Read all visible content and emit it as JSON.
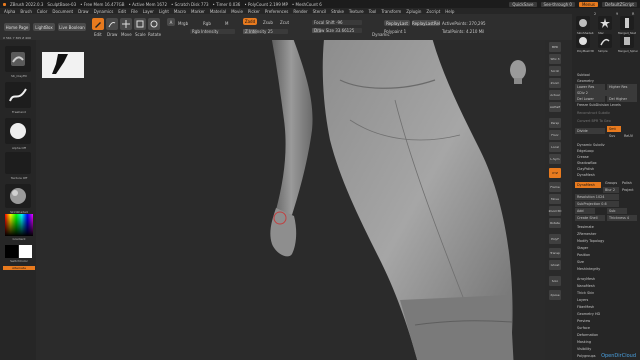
{
  "titlebar": {
    "app": "ZBrush 2022.0.3",
    "file": "SculptBase-03",
    "free_mem": "• Free Mem 16.477GB",
    "active_mem": "• Active Mem 1672",
    "scratch_disk": "• Scratch Disk 773",
    "timer": "• Timer 0.036",
    "polycount": "• PolyCount 2.199 MP",
    "meshcount": "• MeshCount 6",
    "quicksave": "QuickSave",
    "see_through": "See-through 0",
    "menus_btn": "Menus",
    "default_zscript": "DefaultZScript"
  },
  "menubar": [
    "Alpha",
    "Brush",
    "Color",
    "Document",
    "Draw",
    "Dynamics",
    "Edit",
    "File",
    "Layer",
    "Light",
    "Macro",
    "Marker",
    "Material",
    "Movie",
    "Picker",
    "Preferences",
    "Render",
    "Stencil",
    "Stroke",
    "Texture",
    "Tool",
    "Transform",
    "Zplugin",
    "Zscript",
    "Help"
  ],
  "toolbar": {
    "home_page": "Home Page",
    "lightbox": "LightBox",
    "live_boolean": "Live Boolean",
    "edit": "Edit",
    "draw": "Draw",
    "move": "Move",
    "scale": "Scale",
    "rotate": "Rotate",
    "a_label": "A",
    "mrgb": "Mrgb",
    "rgb": "Rgb",
    "m": "M",
    "zadd": "Zadd",
    "zsub": "Zsub",
    "zcut": "Zcut",
    "rgb_intensity": "Rgb Intensity",
    "z_intensity": "Z Intensity 25",
    "focal_shift": "Focal Shift -96",
    "draw_size": "Draw Size 33.66125",
    "dynamic": "Dynamic",
    "replay_last": "ReplayLast",
    "replay_last_rel": "ReplayLastRel",
    "polypaint": "Polypaint 1",
    "active_points": "ActivePoints: 270,295",
    "total_points": "TotalPoints: 4.210 Mil",
    "coords": "X 561 Y 305 Z 400"
  },
  "leftpanel": {
    "brush_name": "SK_ClayFill",
    "stroke_name": "Freehand",
    "alpha_name": "Alpha Off",
    "texture_name": "Texture Off",
    "material_name": "SkinShade4",
    "gradient": "Gradient",
    "switch_color": "SwitchColor",
    "alternate": "Alternate"
  },
  "rightshelf": [
    "BPR",
    "SPix 3",
    "Scroll",
    "Zoom",
    "Actual",
    "AAHalf",
    "Persp",
    "Floor",
    "Local",
    "L.Sym",
    "XYZ",
    "Frame",
    "Move",
    "Zoom3D",
    "Rotate",
    "PolyF",
    "Transp",
    "Ghost",
    "Solo",
    "Xpose"
  ],
  "rightpanel": {
    "thumbs": [
      "SkinShade4",
      "Star",
      "PolyMesh3D",
      "Simple",
      "Merged_Spher",
      "Merged_Sket"
    ],
    "counts": [
      "2",
      "9",
      "R"
    ],
    "items": [
      "Subtool",
      "Geometry",
      "Lower Res",
      "Higher Res",
      "SDiv 2",
      "Del Lower",
      "Del Higher",
      "Freeze SubDivision Levels",
      "Reconstruct Subdiv",
      "Convert BPR To Geo",
      "Divide",
      "Smt",
      "Suv",
      "ReUV",
      "Dynamic Subdiv",
      "EdgeLoop",
      "Crease",
      "ShadowBox",
      "ClayPolish",
      "DynaMesh",
      "DynaMesh",
      "Groups",
      "Polish",
      "Blur 2",
      "Project",
      "Resolution 1024",
      "SubProjection 0.6",
      "Add",
      "Sub",
      "Create Shell",
      "Thickness 4",
      "Tessimate",
      "ZRemesher",
      "Modify Topology",
      "Stager",
      "Position",
      "Size",
      "MeshIntegrity",
      "ArrayMesh",
      "NanoMesh",
      "Thick Skin",
      "Layers",
      "FiberMesh",
      "Geometry HD",
      "Preview",
      "Surface",
      "Deformation",
      "Masking",
      "Visibility",
      "Polygroups"
    ]
  },
  "brand": "OpenDirCloud",
  "colors": {
    "accent": "#e87a1e",
    "panel": "#262626",
    "canvas": "#2b2b2b",
    "model": "#8a8a8a"
  }
}
